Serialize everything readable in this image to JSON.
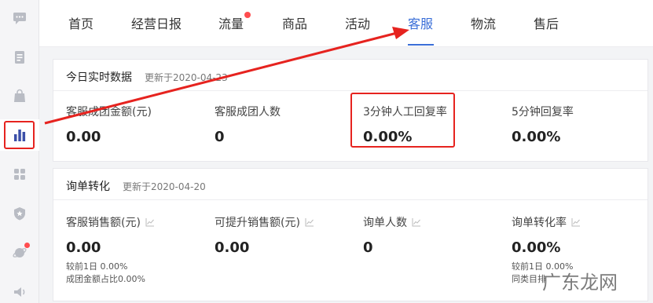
{
  "sidebar": {
    "items": [
      {
        "icon": "chat-icon"
      },
      {
        "icon": "document-icon"
      },
      {
        "icon": "bag-icon"
      },
      {
        "icon": "bar-chart-icon",
        "active": true
      },
      {
        "icon": "apps-grid-icon"
      },
      {
        "icon": "shield-star-icon"
      },
      {
        "icon": "planet-icon",
        "badge": true
      },
      {
        "icon": "speaker-icon"
      }
    ]
  },
  "tabs": [
    {
      "label": "首页"
    },
    {
      "label": "经营日报"
    },
    {
      "label": "流量",
      "badge": true
    },
    {
      "label": "商品"
    },
    {
      "label": "活动"
    },
    {
      "label": "客服",
      "active": true
    },
    {
      "label": "物流"
    },
    {
      "label": "售后"
    }
  ],
  "realtime": {
    "title": "今日实时数据",
    "updated": "更新于2020-04-23",
    "metrics": [
      {
        "label": "客服成团金额(元)",
        "value": "0.00"
      },
      {
        "label": "客服成团人数",
        "value": "0"
      },
      {
        "label": "3分钟人工回复率",
        "value": "0.00%"
      },
      {
        "label": "5分钟回复率",
        "value": "0.00%"
      }
    ]
  },
  "inquiry": {
    "title": "询单转化",
    "updated": "更新于2020-04-20",
    "metrics": [
      {
        "label": "客服销售额(元)",
        "value": "0.00",
        "compare": "较前1日  0.00%",
        "ratio": "成团金额占比0.00%"
      },
      {
        "label": "可提升销售额(元)",
        "value": "0.00"
      },
      {
        "label": "询单人数",
        "value": "0"
      },
      {
        "label": "询单转化率",
        "value": "0.00%",
        "compare": "较前1日  0.00%",
        "ratio": "同类目排"
      }
    ]
  },
  "watermark": "广东龙网",
  "colors": {
    "accent": "#3b6fd8",
    "annotation": "#e6231f",
    "badge": "#ff4d4f"
  }
}
